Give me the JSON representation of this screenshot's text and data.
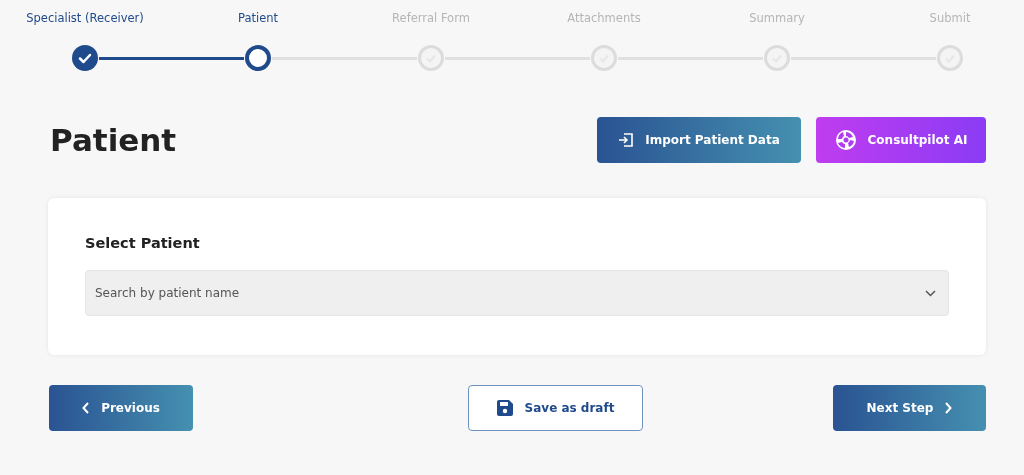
{
  "steps": [
    {
      "label": "Specialist (Receiver)",
      "kind": "done"
    },
    {
      "label": "Patient",
      "kind": "current"
    },
    {
      "label": "Referral Form",
      "kind": "upcoming"
    },
    {
      "label": "Attachments",
      "kind": "upcoming"
    },
    {
      "label": "Summary",
      "kind": "upcoming"
    },
    {
      "label": "Submit",
      "kind": "upcoming"
    }
  ],
  "page_title": "Patient",
  "header_buttons": [
    {
      "label": "Import Patient Data",
      "kind": "import"
    },
    {
      "label": "Consultpilot AI",
      "kind": "ai"
    }
  ],
  "card": {
    "title": "Select Patient",
    "select": {
      "placeholder": "Search by patient name"
    }
  },
  "footer_buttons": [
    {
      "label": "Previous",
      "kind": "previous"
    },
    {
      "label": "Save as draft",
      "kind": "draft"
    },
    {
      "label": "Next Step",
      "kind": "next"
    }
  ]
}
